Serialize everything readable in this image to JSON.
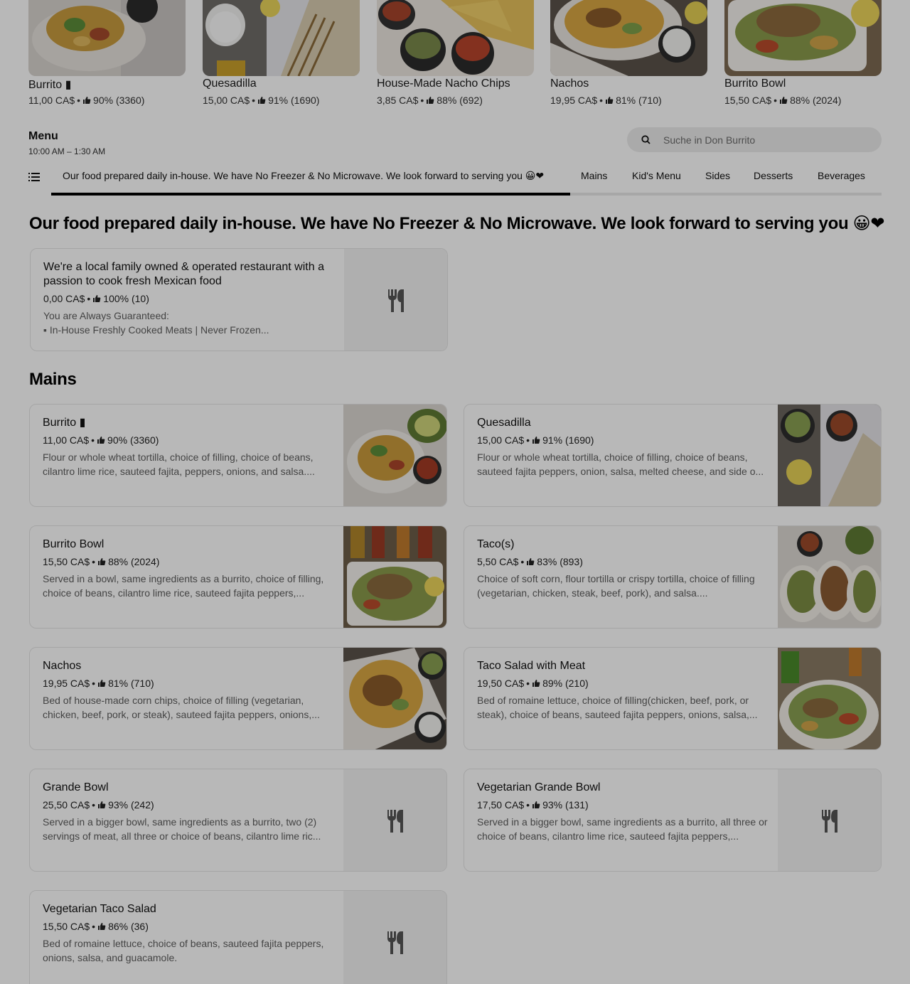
{
  "featured": [
    {
      "name": "Burrito ▮",
      "price": "11,00 CA$",
      "rating": "90% (3360)"
    },
    {
      "name": "Quesadilla",
      "price": "15,00 CA$",
      "rating": "91% (1690)"
    },
    {
      "name": "House-Made Nacho Chips",
      "price": "3,85 CA$",
      "rating": "88% (692)"
    },
    {
      "name": "Nachos",
      "price": "19,95 CA$",
      "rating": "81% (710)"
    },
    {
      "name": "Burrito Bowl",
      "price": "15,50 CA$",
      "rating": "88% (2024)"
    }
  ],
  "menu": {
    "title": "Menu",
    "hours": "10:00 AM – 1:30 AM"
  },
  "search": {
    "placeholder": "Suche in Don Burrito"
  },
  "tabs": [
    {
      "label": "Our food prepared daily in-house. We have No Freezer & No Microwave. We look forward to serving you 😀❤"
    },
    {
      "label": "Mains"
    },
    {
      "label": "Kid's Menu"
    },
    {
      "label": "Sides"
    },
    {
      "label": "Desserts"
    },
    {
      "label": "Beverages"
    }
  ],
  "section1": {
    "title": "Our food prepared daily in-house. We have No Freezer & No Microwave. We look forward to serving you 😀❤",
    "item": {
      "name": "We're a local family owned & operated restaurant with a passion to cook fresh Mexican food",
      "price": "0,00 CA$",
      "rating": "100% (10)",
      "desc1": "You are Always Guaranteed:",
      "desc2": "▪ In-House Freshly Cooked Meats | Never Frozen..."
    }
  },
  "mains": {
    "title": "Mains",
    "items": [
      {
        "name": "Burrito ▮",
        "price": "11,00 CA$",
        "rating": "90% (3360)",
        "desc": "Flour or whole wheat tortilla, choice of filling, choice of beans, cilantro lime rice, sauteed fajita, peppers, onions, and salsa...."
      },
      {
        "name": "Quesadilla",
        "price": "15,00 CA$",
        "rating": "91% (1690)",
        "desc": "Flour or whole wheat tortilla, choice of filling, choice of beans, sauteed fajita peppers, onion, salsa, melted cheese, and side o..."
      },
      {
        "name": "Burrito Bowl",
        "price": "15,50 CA$",
        "rating": "88% (2024)",
        "desc": "Served in a bowl, same ingredients as a burrito, choice of filling, choice of beans, cilantro lime rice, sauteed fajita peppers,..."
      },
      {
        "name": "Taco(s)",
        "price": "5,50 CA$",
        "rating": "83% (893)",
        "desc": "Choice of soft corn, flour tortilla or crispy tortilla, choice of filling (vegetarian, chicken, steak, beef, pork), and salsa...."
      },
      {
        "name": "Nachos",
        "price": "19,95 CA$",
        "rating": "81% (710)",
        "desc": "Bed of house-made corn chips, choice of filling (vegetarian, chicken, beef, pork, or steak), sauteed fajita peppers, onions,..."
      },
      {
        "name": "Taco Salad with Meat",
        "price": "19,50 CA$",
        "rating": "89% (210)",
        "desc": "Bed of romaine lettuce, choice of filling(chicken, beef, pork, or steak), choice of beans, sauteed fajita peppers, onions, salsa,..."
      },
      {
        "name": "Grande Bowl",
        "price": "25,50 CA$",
        "rating": "93% (242)",
        "desc": "Served in a bigger bowl, same ingredients as a burrito, two (2) servings of meat, all three or choice of beans, cilantro lime ric..."
      },
      {
        "name": "Vegetarian Grande Bowl",
        "price": "17,50 CA$",
        "rating": "93% (131)",
        "desc": "Served in a bigger bowl, same ingredients as a burrito, all three or choice of beans, cilantro lime rice, sauteed fajita peppers,..."
      },
      {
        "name": "Vegetarian Taco Salad",
        "price": "15,50 CA$",
        "rating": "86% (36)",
        "desc": "Bed of romaine lettuce, choice of beans, sauteed fajita peppers, onions, salsa, and guacamole."
      }
    ]
  },
  "separator": "•",
  "icons": {
    "thumb": "thumbs-up-icon",
    "search": "search-icon",
    "list": "list-icon",
    "placeholder": "fork-knife-icon"
  }
}
